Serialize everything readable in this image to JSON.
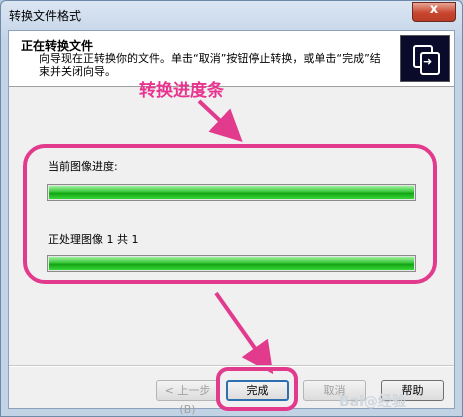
{
  "window": {
    "title": "转换文件格式",
    "close_glyph": "x"
  },
  "header": {
    "title": "正在转换文件",
    "description": "向导现在正转换你的文件。单击“取消”按钮停止转换，或单击“完成”结束并关闭向导。",
    "icon": "convert-documents-icon"
  },
  "annotation": {
    "text": "转换进度条",
    "color": "#e8338f"
  },
  "progress": {
    "current_label": "当前图像进度:",
    "current_value": 1.0,
    "overall_label": "正处理图像 1 共 1",
    "overall_value": 1.0
  },
  "buttons": {
    "back": "< 上一步(B)",
    "finish": "完成",
    "cancel": "取消",
    "help": "帮助"
  },
  "watermark": "Bai@经验"
}
